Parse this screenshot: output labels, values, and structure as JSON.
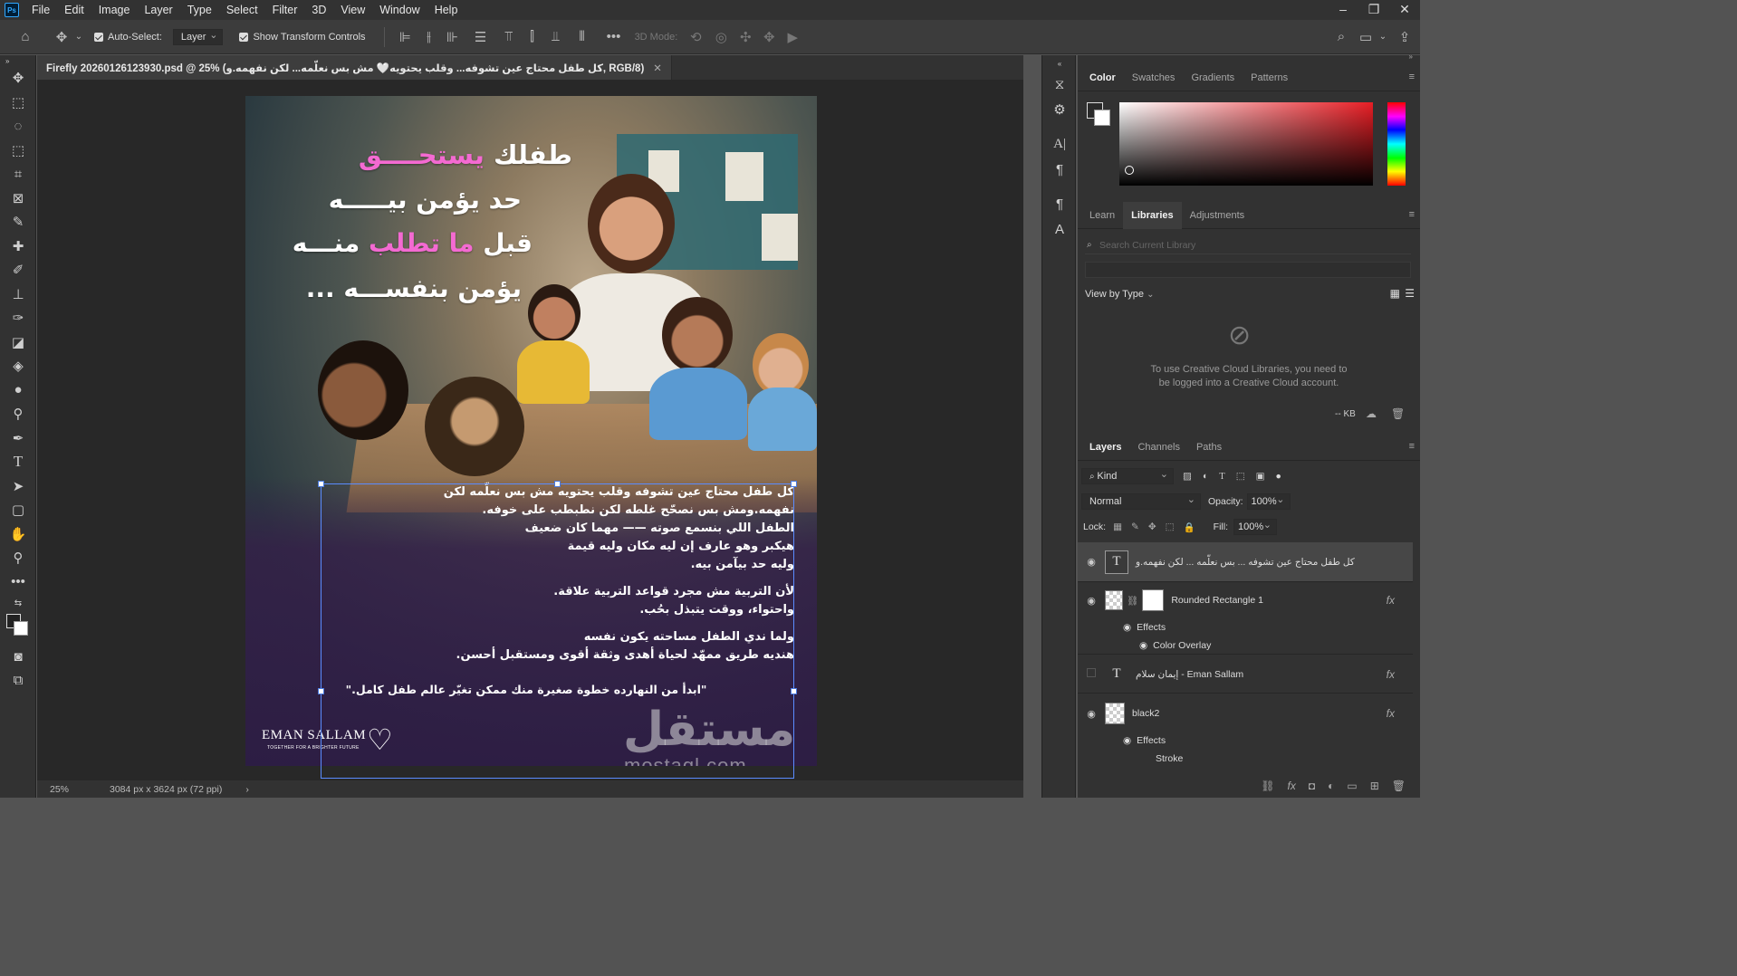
{
  "menubar": {
    "logo": "Ps",
    "items": [
      "File",
      "Edit",
      "Image",
      "Layer",
      "Type",
      "Select",
      "Filter",
      "3D",
      "View",
      "Window",
      "Help"
    ]
  },
  "options": {
    "auto_select_label": "Auto-Select:",
    "auto_select_value": "Layer",
    "transform_label": "Show Transform Controls",
    "mode_label": "3D Mode:"
  },
  "document": {
    "tab_title": "Firefly 20260126123930.psd @ 25% (كل طفل محتاج عين تشوفه... وقلب يحتويه🤍 مش بس نعلّمه... لكن نفهمه.و, RGB/8)",
    "zoom": "25%",
    "size_info": "3084 px x 3624 px (72 ppi)"
  },
  "artwork": {
    "headline": [
      "طفلك",
      "يستحــــق",
      "حد يؤمن بيـــــه",
      "قبل",
      "ما تطلب",
      "منـــه",
      "يؤمن بنفســـه ..."
    ],
    "body_paragraphs": [
      [
        "كل طفل محتاج عين تشوفه   وقلب يحتويه   مش بس نعلّمه   لكن",
        "نفهمه.ومش بس نصحّح غلطه   لكن نطبطب على خوفه.",
        "الطفل اللي بنسمع صوته —— مهما كان ضعيف",
        "هيكبر وهو عارف إن ليه  مكان   وليه قيمة",
        "وليه حد بيآمن بيه."
      ],
      [
        "لأن التربية مش مجرد قواعد   التربية علاقة.",
        "واحتواء، ووقت يتبذل بحُب."
      ],
      [
        "ولما ندي الطفل مساحته يكون نفسه",
        "هنديه طريق ممهّد لحياة أهدى   وثقة أقوى   ومستقبل أحسن."
      ]
    ],
    "quote": "\"ابدأ من النهارده   خطوة صغيرة منك ممكن تغيّر عالم طفل كامل.\"",
    "logo_name": "EMAN SALLAM",
    "logo_tagline": "TOGETHER FOR A BRIGHTER FUTURE",
    "watermark_arabic": "مستقل",
    "watermark_latin": "mostaql.com"
  },
  "color_panel": {
    "tabs": [
      "Color",
      "Swatches",
      "Gradients",
      "Patterns"
    ],
    "active": "Color"
  },
  "libraries_panel": {
    "tabs": [
      "Learn",
      "Libraries",
      "Adjustments"
    ],
    "active": "Libraries",
    "search_placeholder": "Search Current Library",
    "view_by": "View by Type",
    "message": "To use Creative Cloud Libraries, you need to be logged into a Creative Cloud account.",
    "kb": "-- KB"
  },
  "layers_panel": {
    "tabs": [
      "Layers",
      "Channels",
      "Paths"
    ],
    "active": "Layers",
    "kind": "Kind",
    "blend_mode": "Normal",
    "opacity_label": "Opacity:",
    "opacity": "100%",
    "lock_label": "Lock:",
    "fill_label": "Fill:",
    "fill": "100%",
    "layers": [
      {
        "name": "كل طفل محتاج عين تشوفه ... بس نعلّمه ... لكن  نفهمه.و",
        "type": "text",
        "visible": true,
        "selected": true
      },
      {
        "name": "Rounded Rectangle 1",
        "type": "shape",
        "visible": true,
        "effects_label": "Effects",
        "effects": [
          "Color Overlay"
        ]
      },
      {
        "name": "إيمان سلام - Eman Sallam",
        "type": "text",
        "visible": false
      },
      {
        "name": "black2",
        "type": "raster",
        "visible": true,
        "effects_label": "Effects",
        "effects": [
          "Stroke"
        ]
      }
    ]
  },
  "colors": {
    "accent_pink": "#f46ad2",
    "selection": "#5a8cff"
  }
}
